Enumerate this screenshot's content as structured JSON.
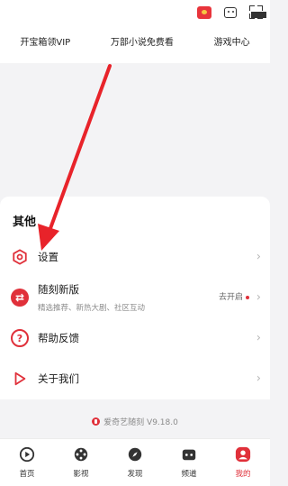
{
  "header": {
    "promo_items": [
      "开宝箱领VIP",
      "万部小说免费看",
      "游戏中心"
    ]
  },
  "others": {
    "title": "其他",
    "settings": {
      "label": "设置"
    },
    "suike": {
      "label": "随刻新版",
      "subtitle": "精选推荐、新热大剧、社区互动",
      "action": "去开启"
    },
    "help": {
      "label": "帮助反馈"
    },
    "about": {
      "label": "关于我们"
    }
  },
  "footer": {
    "version": "爱奇艺随刻 V9.18.0"
  },
  "tabbar": {
    "items": [
      {
        "label": "首页",
        "icon": "home-icon"
      },
      {
        "label": "影视",
        "icon": "film-reel-icon"
      },
      {
        "label": "发现",
        "icon": "compass-icon"
      },
      {
        "label": "频道",
        "icon": "channel-icon"
      },
      {
        "label": "我的",
        "icon": "profile-icon"
      }
    ],
    "active_index": 4
  },
  "colors": {
    "accent": "#e0303a",
    "arrow": "#e8232a"
  }
}
